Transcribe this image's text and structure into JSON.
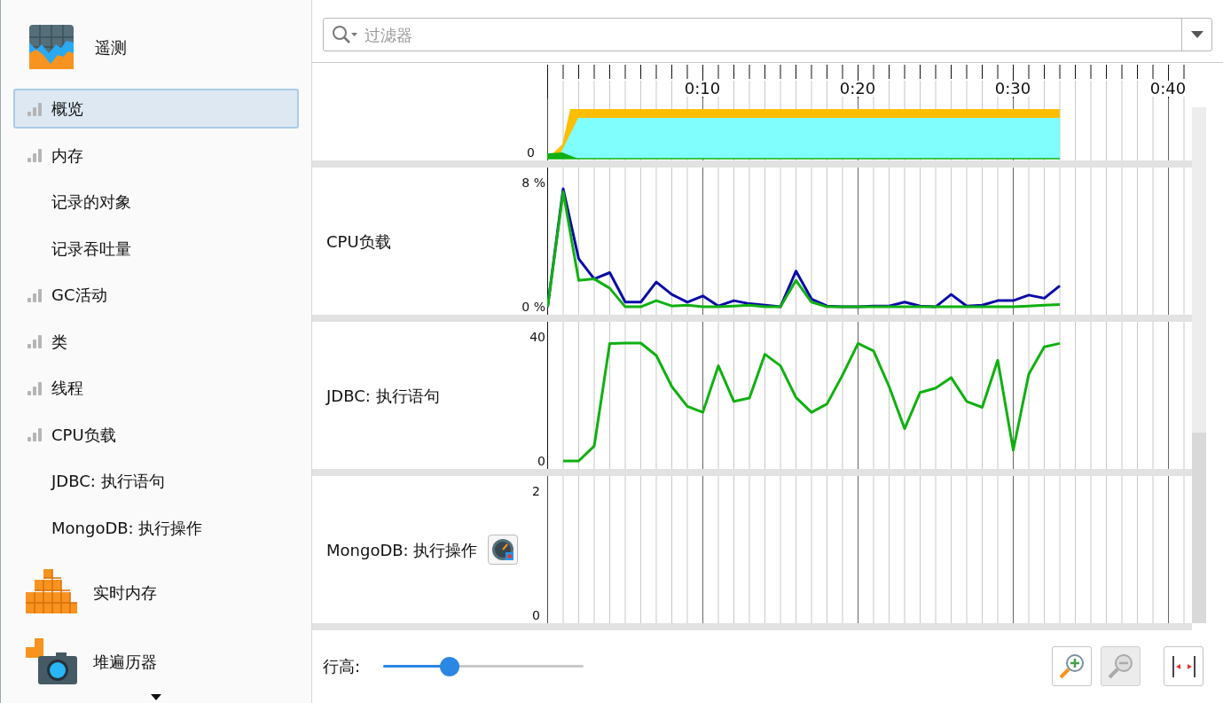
{
  "sidebar": {
    "header": {
      "label": "遥测"
    },
    "items": [
      {
        "label": "概览",
        "kind": "chart",
        "selected": true
      },
      {
        "label": "内存",
        "kind": "chart",
        "selected": false
      },
      {
        "label": "记录的对象",
        "kind": "plain",
        "selected": false
      },
      {
        "label": "记录吞吐量",
        "kind": "plain",
        "selected": false
      },
      {
        "label": "GC活动",
        "kind": "chart",
        "selected": false
      },
      {
        "label": "类",
        "kind": "chart",
        "selected": false
      },
      {
        "label": "线程",
        "kind": "chart",
        "selected": false
      },
      {
        "label": "CPU负载",
        "kind": "chart",
        "selected": false
      },
      {
        "label": "JDBC: 执行语句",
        "kind": "plain",
        "selected": false
      },
      {
        "label": "MongoDB: 执行操作",
        "kind": "plain",
        "selected": false
      }
    ],
    "sections": [
      {
        "label": "实时内存",
        "kind": "cubes"
      },
      {
        "label": "堆遍历器",
        "kind": "camera"
      }
    ]
  },
  "filter": {
    "placeholder": "过滤器"
  },
  "timeline": {
    "ticks": [
      "0:10",
      "0:20",
      "0:30",
      "0:40"
    ]
  },
  "overview": {
    "ytick": "0"
  },
  "rows": [
    {
      "label": "CPU负载",
      "kind": "line",
      "chart_data": {
        "type": "line",
        "grid": true,
        "ylim": [
          -0.51,
          8.97
        ],
        "yticks": [
          {
            "value": 0,
            "label": "0 %"
          },
          {
            "value": 8,
            "label": "8 %"
          }
        ],
        "categories": [
          null,
          null,
          null,
          null,
          null,
          null,
          null,
          null,
          null,
          null,
          null,
          null,
          null,
          null,
          null,
          null,
          null,
          null,
          null,
          null,
          null,
          null,
          null,
          null,
          null,
          null,
          null,
          null,
          null,
          null,
          null,
          null,
          null,
          null
        ],
        "series": [
          {
            "color": "#0a0aa8",
            "values": [
              0,
              7.6,
              3.1,
              1.8,
              2.2,
              0.3,
              0.3,
              1.6,
              0.8,
              0.3,
              0.7,
              0.05,
              0.4,
              0.2,
              0.1,
              0,
              2.3,
              0.5,
              0.05,
              0,
              0,
              0.05,
              0.05,
              0.3,
              0.05,
              0,
              0.8,
              0.05,
              0.1,
              0.4,
              0.4,
              0.75,
              0.55,
              1.35
            ]
          },
          {
            "color": "#10b010",
            "values": [
              0,
              7.4,
              1.7,
              1.8,
              1.2,
              0,
              0,
              0.4,
              0.05,
              0.1,
              0,
              0,
              0.05,
              0.1,
              0,
              0,
              1.7,
              0.3,
              0,
              0,
              0,
              0,
              0,
              0,
              0,
              0,
              0,
              0,
              0,
              0,
              0,
              0.05,
              0.1,
              0.15
            ]
          }
        ]
      }
    },
    {
      "label": "JDBC: 执行语句",
      "kind": "line",
      "chart_data": {
        "type": "line",
        "grid": true,
        "ylim": [
          -2.57,
          44.86
        ],
        "yticks": [
          0,
          40
        ],
        "categories": [
          null,
          null,
          null,
          null,
          null,
          null,
          null,
          null,
          null,
          null,
          null,
          null,
          null,
          null,
          null,
          null,
          null,
          null,
          null,
          null,
          null,
          null,
          null,
          null,
          null,
          null,
          null,
          null,
          null,
          null,
          null,
          null,
          null,
          null
        ],
        "series": [
          {
            "color": "#10b010",
            "values": [
              null,
              0,
              0,
              4.8,
              37.9,
              38,
              38,
              34,
              24,
              17.6,
              15.7,
              30.7,
              19.2,
              20.3,
              34.4,
              30.7,
              20.5,
              15.7,
              18.4,
              27.7,
              37.9,
              35.5,
              24,
              10.4,
              22.1,
              23.5,
              26.9,
              19.2,
              17.3,
              32.5,
              3.5,
              28,
              36.8,
              37.9
            ]
          }
        ]
      }
    },
    {
      "label": "MongoDB: 执行操作",
      "kind": "line",
      "action": true,
      "scale_labels": [
        "2",
        "0"
      ]
    }
  ],
  "row_height": {
    "label": "行高:",
    "level": 0.33
  },
  "toolbar": [
    {
      "kind": "zoom-in",
      "disabled": false
    },
    {
      "kind": "zoom-out",
      "disabled": true
    },
    {
      "kind": "fit",
      "disabled": false
    }
  ]
}
